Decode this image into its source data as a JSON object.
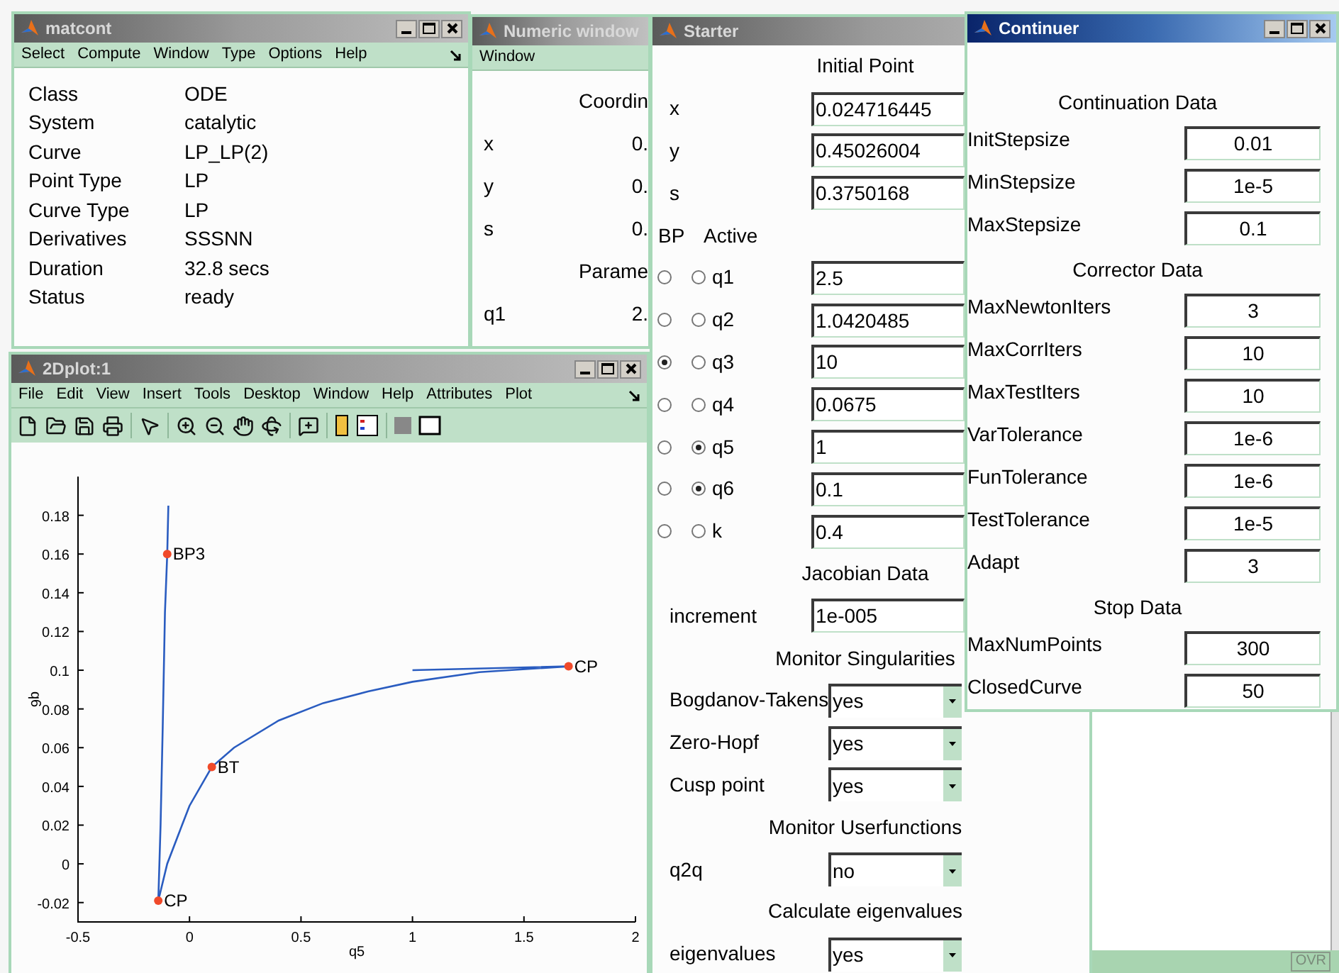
{
  "matcont": {
    "title": "matcont",
    "menu": [
      "Select",
      "Compute",
      "Window",
      "Type",
      "Options",
      "Help"
    ],
    "rows": [
      {
        "label": "Class",
        "value": "ODE"
      },
      {
        "label": "System",
        "value": "catalytic"
      },
      {
        "label": "Curve",
        "value": "LP_LP(2)"
      },
      {
        "label": "Point Type",
        "value": "LP"
      },
      {
        "label": "Curve Type",
        "value": "LP"
      },
      {
        "label": "Derivatives",
        "value": "SSSNN"
      },
      {
        "label": "Duration",
        "value": "32.8 secs"
      },
      {
        "label": "Status",
        "value": "ready"
      }
    ]
  },
  "numeric_window": {
    "title": "Numeric window",
    "menu": [
      "Window"
    ],
    "rows": [
      {
        "kind": "heading",
        "label": "Coordin"
      },
      {
        "kind": "value",
        "label": "x",
        "value": "0."
      },
      {
        "kind": "value",
        "label": "y",
        "value": "0."
      },
      {
        "kind": "value",
        "label": "s",
        "value": "0."
      },
      {
        "kind": "heading",
        "label": "Parame"
      },
      {
        "kind": "value",
        "label": "q1",
        "value": "2."
      }
    ]
  },
  "plot_window": {
    "title": "2Dplot:1",
    "menu": [
      "File",
      "Edit",
      "View",
      "Insert",
      "Tools",
      "Desktop",
      "Window",
      "Help",
      "Attributes",
      "Plot"
    ],
    "chart_data": {
      "type": "line",
      "xlabel": "q5",
      "ylabel": "q6",
      "xlim": [
        -0.5,
        2
      ],
      "ylim": [
        -0.03,
        0.2
      ],
      "xticks": [
        -0.5,
        0,
        0.5,
        1,
        1.5,
        2
      ],
      "yticks": [
        -0.02,
        0,
        0.02,
        0.04,
        0.06,
        0.08,
        0.1,
        0.12,
        0.14,
        0.16,
        0.18
      ],
      "series": [
        {
          "color": "#2a5cc0",
          "x": [
            -0.14,
            -0.13,
            -0.12,
            -0.11,
            -0.1,
            -0.095
          ],
          "values": [
            -0.019,
            0.02,
            0.07,
            0.13,
            0.16,
            0.185
          ]
        },
        {
          "color": "#2a5cc0",
          "x": [
            -0.14,
            -0.1,
            -0.05,
            0,
            0.1,
            0.2,
            0.4,
            0.6,
            0.8,
            1.0,
            1.3,
            1.7,
            1.0
          ],
          "values": [
            -0.019,
            0.0,
            0.015,
            0.03,
            0.05,
            0.06,
            0.074,
            0.083,
            0.089,
            0.094,
            0.099,
            0.102,
            0.1
          ]
        }
      ],
      "annotations": [
        {
          "x": -0.1,
          "y": 0.16,
          "text": "BP3"
        },
        {
          "x": 1.7,
          "y": 0.102,
          "text": "CP"
        },
        {
          "x": 0.1,
          "y": 0.05,
          "text": "BT"
        },
        {
          "x": -0.14,
          "y": -0.019,
          "text": "CP"
        }
      ]
    }
  },
  "starter": {
    "title": "Starter",
    "rows": [
      {
        "kind": "heading",
        "label": "Initial Point"
      },
      {
        "kind": "field",
        "label": "x",
        "value": "0.024716445"
      },
      {
        "kind": "field",
        "label": "y",
        "value": "0.45026004"
      },
      {
        "kind": "field",
        "label": "s",
        "value": "0.3750168"
      },
      {
        "kind": "columns",
        "label": "BP",
        "value": "Active"
      },
      {
        "kind": "param",
        "label": "q1",
        "value": "2.5",
        "bp": false,
        "active": false
      },
      {
        "kind": "param",
        "label": "q2",
        "value": "1.0420485",
        "bp": false,
        "active": false
      },
      {
        "kind": "param",
        "label": "q3",
        "value": "10",
        "bp": true,
        "active": false
      },
      {
        "kind": "param",
        "label": "q4",
        "value": "0.0675",
        "bp": false,
        "active": false
      },
      {
        "kind": "param",
        "label": "q5",
        "value": "1",
        "bp": false,
        "active": true
      },
      {
        "kind": "param",
        "label": "q6",
        "value": "0.1",
        "bp": false,
        "active": true
      },
      {
        "kind": "param",
        "label": "k",
        "value": "0.4",
        "bp": false,
        "active": false
      },
      {
        "kind": "heading",
        "label": "Jacobian Data"
      },
      {
        "kind": "field",
        "label": "increment",
        "value": "1e-005"
      },
      {
        "kind": "heading",
        "label": "Monitor Singularities"
      },
      {
        "kind": "dropdown",
        "label": "Bogdanov-Takens",
        "value": "yes"
      },
      {
        "kind": "dropdown",
        "label": "Zero-Hopf",
        "value": "yes"
      },
      {
        "kind": "dropdown",
        "label": "Cusp point",
        "value": "yes"
      },
      {
        "kind": "heading",
        "label": "Monitor Userfunctions"
      },
      {
        "kind": "dropdown",
        "label": "q2q",
        "value": "no"
      },
      {
        "kind": "heading",
        "label": "Calculate eigenvalues"
      },
      {
        "kind": "dropdown",
        "label": "eigenvalues",
        "value": "yes"
      }
    ]
  },
  "continuer": {
    "title": "Continuer",
    "rows": [
      {
        "kind": "heading",
        "label": "Continuation Data"
      },
      {
        "kind": "field",
        "label": "InitStepsize",
        "value": "0.01"
      },
      {
        "kind": "field",
        "label": "MinStepsize",
        "value": "1e-5"
      },
      {
        "kind": "field",
        "label": "MaxStepsize",
        "value": "0.1"
      },
      {
        "kind": "heading",
        "label": "Corrector Data"
      },
      {
        "kind": "field",
        "label": "MaxNewtonIters",
        "value": "3"
      },
      {
        "kind": "field",
        "label": "MaxCorrIters",
        "value": "10"
      },
      {
        "kind": "field",
        "label": "MaxTestIters",
        "value": "10"
      },
      {
        "kind": "field",
        "label": "VarTolerance",
        "value": "1e-6"
      },
      {
        "kind": "field",
        "label": "FunTolerance",
        "value": "1e-6"
      },
      {
        "kind": "field",
        "label": "TestTolerance",
        "value": "1e-5"
      },
      {
        "kind": "field",
        "label": "Adapt",
        "value": "3"
      },
      {
        "kind": "heading",
        "label": "Stop Data"
      },
      {
        "kind": "field",
        "label": "MaxNumPoints",
        "value": "300"
      },
      {
        "kind": "field",
        "label": "ClosedCurve",
        "value": "50"
      }
    ]
  },
  "editor_window": {
    "status": "OVR"
  }
}
